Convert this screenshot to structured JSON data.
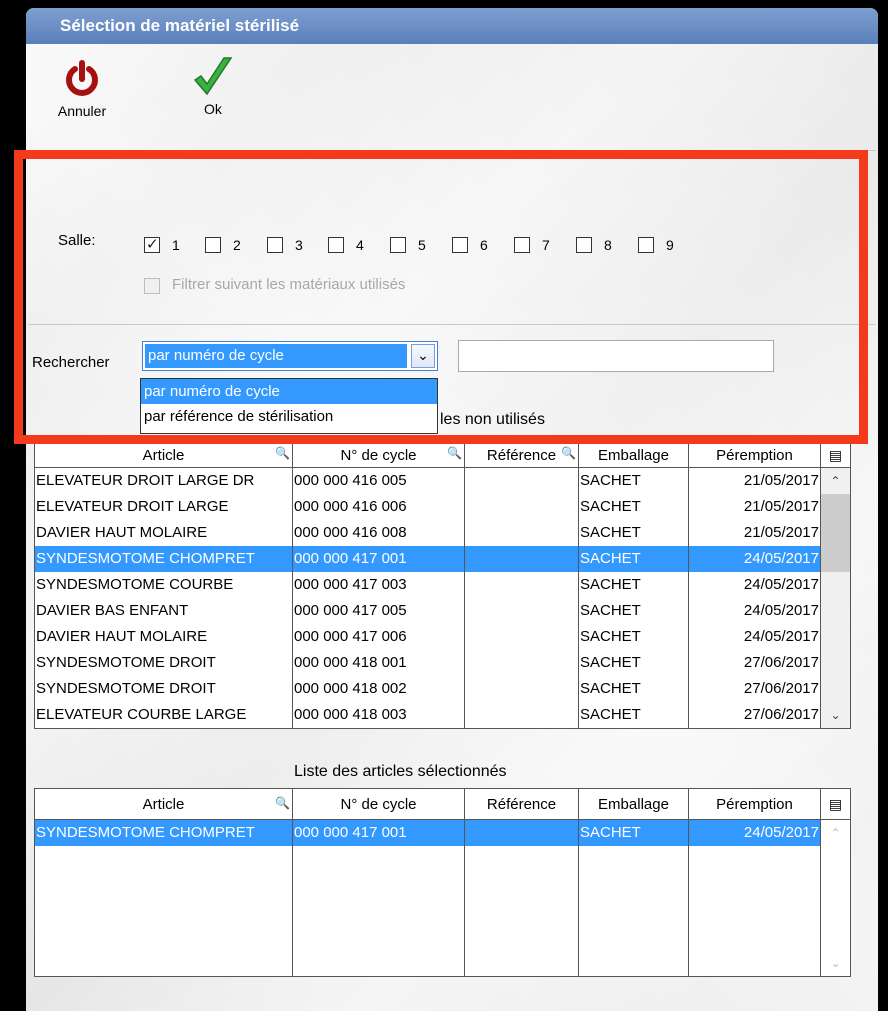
{
  "window": {
    "title": "Sélection de matériel stérilisé"
  },
  "toolbar": {
    "cancel_label": "Annuler",
    "ok_label": "Ok"
  },
  "filters": {
    "salle_label": "Salle:",
    "rooms": [
      "1",
      "2",
      "3",
      "4",
      "5",
      "6",
      "7",
      "8",
      "9"
    ],
    "checked_room": "1",
    "filter_used_label": "Filtrer suivant les matériaux utilisés",
    "search_label": "Rechercher",
    "search_mode_selected": "par numéro de cycle",
    "search_mode_options": [
      "par numéro de cycle",
      "par référence de stérilisation"
    ],
    "search_value": ""
  },
  "available": {
    "title_partial": "les non utilisés",
    "columns": [
      "Article",
      "N° de cycle",
      "Référence",
      "Emballage",
      "Péremption"
    ],
    "rows": [
      {
        "article": "ELEVATEUR DROIT LARGE DR",
        "cycle": "000 000 416 005",
        "ref": "",
        "pack": "SACHET",
        "exp": "21/05/2017",
        "selected": false
      },
      {
        "article": "ELEVATEUR DROIT LARGE",
        "cycle": "000 000 416 006",
        "ref": "",
        "pack": "SACHET",
        "exp": "21/05/2017",
        "selected": false
      },
      {
        "article": "DAVIER HAUT MOLAIRE",
        "cycle": "000 000 416 008",
        "ref": "",
        "pack": "SACHET",
        "exp": "21/05/2017",
        "selected": false
      },
      {
        "article": "SYNDESMOTOME CHOMPRET",
        "cycle": "000 000 417 001",
        "ref": "",
        "pack": "SACHET",
        "exp": "24/05/2017",
        "selected": true
      },
      {
        "article": "SYNDESMOTOME COURBE",
        "cycle": "000 000 417 003",
        "ref": "",
        "pack": "SACHET",
        "exp": "24/05/2017",
        "selected": false
      },
      {
        "article": "DAVIER BAS ENFANT",
        "cycle": "000 000 417 005",
        "ref": "",
        "pack": "SACHET",
        "exp": "24/05/2017",
        "selected": false
      },
      {
        "article": "DAVIER HAUT MOLAIRE",
        "cycle": "000 000 417 006",
        "ref": "",
        "pack": "SACHET",
        "exp": "24/05/2017",
        "selected": false
      },
      {
        "article": "SYNDESMOTOME DROIT",
        "cycle": "000 000 418 001",
        "ref": "",
        "pack": "SACHET",
        "exp": "27/06/2017",
        "selected": false
      },
      {
        "article": "SYNDESMOTOME DROIT",
        "cycle": "000 000 418 002",
        "ref": "",
        "pack": "SACHET",
        "exp": "27/06/2017",
        "selected": false
      },
      {
        "article": "ELEVATEUR COURBE LARGE",
        "cycle": "000 000 418 003",
        "ref": "",
        "pack": "SACHET",
        "exp": "27/06/2017",
        "selected": false
      }
    ]
  },
  "selected_list": {
    "title": "Liste des articles sélectionnés",
    "columns": [
      "Article",
      "N° de cycle",
      "Référence",
      "Emballage",
      "Péremption"
    ],
    "rows": [
      {
        "article": "SYNDESMOTOME CHOMPRET",
        "cycle": "000 000 417 001",
        "ref": "",
        "pack": "SACHET",
        "exp": "24/05/2017",
        "selected": true
      }
    ]
  },
  "colors": {
    "title_bar": "#5b7fbc",
    "selection": "#3399ff",
    "highlight_box": "#f33a1a"
  },
  "icons": {
    "cancel": "power-icon",
    "ok": "checkmark-icon",
    "column_search": "magnifier-icon",
    "column_config": "table-config-icon"
  }
}
